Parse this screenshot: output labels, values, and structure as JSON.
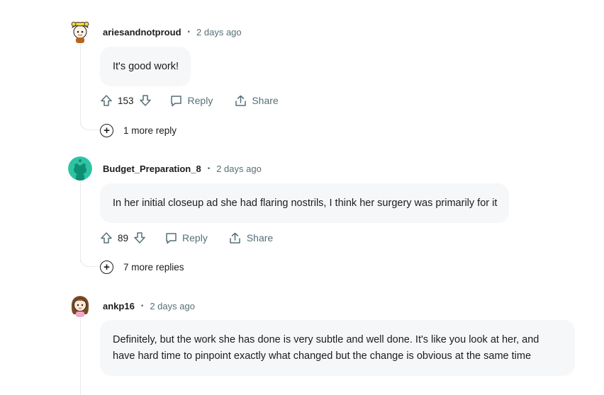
{
  "comments": [
    {
      "author": "ariesandnotproud",
      "time": "2 days ago",
      "text": "It's good work!",
      "votes": "153",
      "reply_label": "Reply",
      "share_label": "Share",
      "more_replies": "1 more reply",
      "avatar_icon": "snoo-avatar-yellow-hair"
    },
    {
      "author": "Budget_Preparation_8",
      "time": "2 days ago",
      "text": "In her initial closeup ad she had flaring nostrils, I think her surgery was primarily for it",
      "votes": "89",
      "reply_label": "Reply",
      "share_label": "Share",
      "more_replies": "7 more replies",
      "avatar_icon": "default-snoo-avatar-teal"
    },
    {
      "author": "ankp16",
      "time": "2 days ago",
      "text": "Definitely, but the work she has done is very subtle and well done. It's like you look at her, and have hard time to pinpoint exactly what changed but the change is obvious at the same time",
      "avatar_icon": "snoo-avatar-brown-hair"
    }
  ],
  "separator": "•",
  "colors": {
    "meta_gray": "#576f76",
    "bubble_bg": "#f6f7f8",
    "thread_line": "#e5ebee",
    "default_avatar": "#2ec4a3"
  }
}
